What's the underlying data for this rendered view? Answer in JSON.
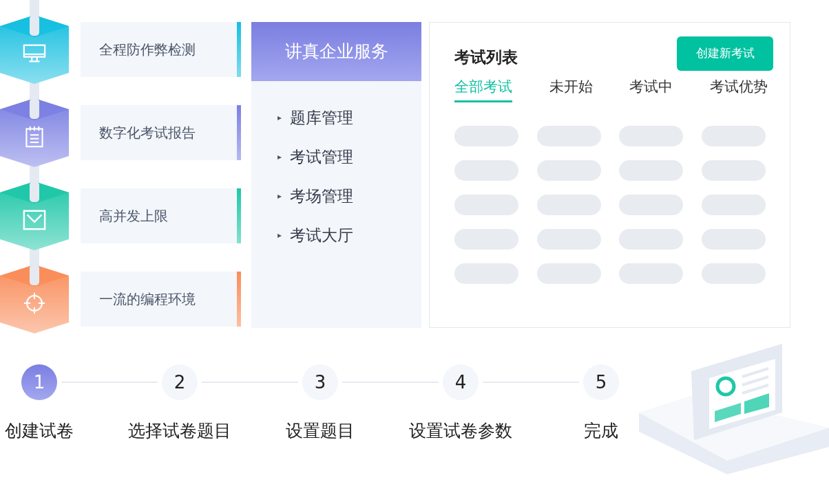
{
  "features": [
    {
      "label": "全程防作弊检测",
      "color": "#16bfe0"
    },
    {
      "label": "数字化考试报告",
      "color": "#7b80e2"
    },
    {
      "label": "高并发上限",
      "color": "#1fc7a8"
    },
    {
      "label": "一流的编程环境",
      "color": "#f98d5a"
    }
  ],
  "service_panel": {
    "title": "讲真企业服务",
    "items": [
      {
        "marker": "▸",
        "label": "题库管理"
      },
      {
        "marker": "▸",
        "label": "考试管理"
      },
      {
        "marker": "▸",
        "label": "考场管理"
      },
      {
        "marker": "▸",
        "label": "考试大厅"
      }
    ]
  },
  "exam_list": {
    "title": "考试列表",
    "create_button": "创建新考试",
    "tabs": [
      {
        "label": "全部考试",
        "selected": true
      },
      {
        "label": "未开始",
        "selected": false
      },
      {
        "label": "考试中",
        "selected": false
      },
      {
        "label": "考试优势",
        "selected": false
      }
    ]
  },
  "steps": [
    {
      "number": "1",
      "label": "创建试卷",
      "selected": true
    },
    {
      "number": "2",
      "label": "选择试卷题目",
      "selected": false
    },
    {
      "number": "3",
      "label": "设置题目",
      "selected": false
    },
    {
      "number": "4",
      "label": "设置试卷参数",
      "selected": false
    },
    {
      "number": "5",
      "label": "完成",
      "selected": false
    }
  ]
}
